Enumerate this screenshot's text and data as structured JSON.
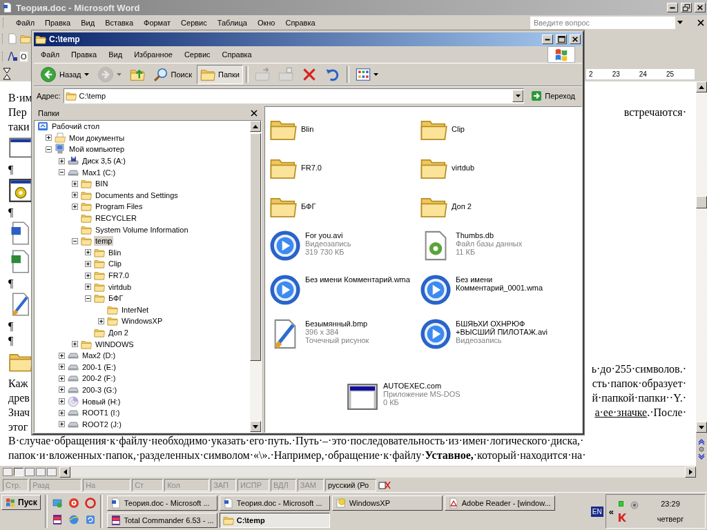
{
  "word": {
    "title": "Теория.doc - Microsoft Word",
    "menu": [
      "Файл",
      "Правка",
      "Вид",
      "Вставка",
      "Формат",
      "Сервис",
      "Таблица",
      "Окно",
      "Справка"
    ],
    "help": {
      "placeholder": "Введите вопрос"
    },
    "style_box": "О",
    "ruler": [
      "2",
      "23",
      "24",
      "25"
    ],
    "document": [
      {
        "kind": "text",
        "left": "В·им"
      },
      {
        "kind": "text",
        "left": "Пер",
        "right": "встречаются·"
      },
      {
        "kind": "text",
        "left": "таки"
      },
      {
        "kind": "window"
      },
      {
        "kind": "text",
        "left": "¶"
      },
      {
        "kind": "settings"
      },
      {
        "kind": "text",
        "left": "¶"
      },
      {
        "kind": "word"
      },
      {
        "kind": "excel"
      },
      {
        "kind": "text",
        "left": "¶"
      },
      {
        "kind": "paint"
      },
      {
        "kind": "text",
        "left": "¶"
      },
      {
        "kind": "text",
        "left": "¶"
      },
      {
        "kind": "folder",
        "right": "ь·до·255·символов.·"
      },
      {
        "kind": "text",
        "left": "Каж",
        "right": "сть·папок·образует·"
      },
      {
        "kind": "text",
        "left": "древ",
        "right": "й·папкой·папки··Y.·"
      },
      {
        "kind": "text",
        "left": "Знач",
        "right_underlined": "а·ее·значке",
        "right": ".·После·"
      },
      {
        "kind": "text",
        "left": "этог"
      },
      {
        "kind": "full",
        "text": "В·случае·обращения·к·файлу·необходимо·указать·его·путь.·Путь·–·это·последовательность·из·имен·логического·диска,·"
      },
      {
        "kind": "full",
        "text": "папок·и·вложенных·папок,·разделенных·символом·«\\».·Например,·обращение·к·файлу·**Уставное,**·который·находится·на·"
      }
    ],
    "status": [
      {
        "label": "Стр.",
        "disabled": true
      },
      {
        "label": "Разд",
        "disabled": true
      },
      {
        "label": "На",
        "disabled": true
      },
      {
        "label": "Ст",
        "disabled": true
      },
      {
        "label": "Кол",
        "disabled": true
      },
      {
        "label": "ЗАП",
        "disabled": true
      },
      {
        "label": "ИСПР",
        "disabled": true
      },
      {
        "label": "ВДЛ",
        "disabled": true
      },
      {
        "label": "ЗАМ",
        "disabled": true
      },
      {
        "label": "русский (Ро",
        "disabled": false
      }
    ]
  },
  "explorer": {
    "title": "C:\\temp",
    "menu": [
      "Файл",
      "Правка",
      "Вид",
      "Избранное",
      "Сервис",
      "Справка"
    ],
    "toolbar": [
      {
        "kind": "back",
        "label": "Назад",
        "disabled": false,
        "pressed": false
      },
      {
        "kind": "forward",
        "disabled": true,
        "pressed": false
      },
      {
        "kind": "up",
        "disabled": false,
        "pressed": false
      },
      {
        "kind": "search",
        "label": "Поиск",
        "disabled": false,
        "pressed": false
      },
      {
        "kind": "folders",
        "label": "Папки",
        "disabled": false,
        "pressed": true
      },
      {
        "kind": "move",
        "disabled": true,
        "pressed": false
      },
      {
        "kind": "copy",
        "disabled": true,
        "pressed": false
      },
      {
        "kind": "delete",
        "disabled": false,
        "pressed": false
      },
      {
        "kind": "undo",
        "disabled": false,
        "pressed": false
      },
      {
        "kind": "views",
        "disabled": false,
        "pressed": false
      }
    ],
    "address": {
      "label": "Адрес:",
      "value": "C:\\temp",
      "go": "Переход"
    },
    "folders_title": "Папки",
    "tree": [
      {
        "label": "Рабочий стол",
        "kind": "desktop",
        "selected": false,
        "children": [
          {
            "label": "Мои документы",
            "kind": "documents",
            "expandable": true,
            "expanded": false,
            "selected": false
          },
          {
            "label": "Мой компьютер",
            "kind": "computer",
            "expandable": true,
            "expanded": true,
            "selected": false,
            "children": [
              {
                "label": "Диск 3,5 (A:)",
                "kind": "floppy",
                "expandable": true,
                "expanded": false,
                "selected": false
              },
              {
                "label": "Max1 (C:)",
                "kind": "drive",
                "expandable": true,
                "expanded": true,
                "selected": false,
                "children": [
                  {
                    "label": "BIN",
                    "kind": "folder",
                    "expandable": true,
                    "expanded": false,
                    "selected": false
                  },
                  {
                    "label": "Documents and Settings",
                    "kind": "folder",
                    "expandable": true,
                    "expanded": false,
                    "selected": false
                  },
                  {
                    "label": "Program Files",
                    "kind": "folder",
                    "expandable": true,
                    "expanded": false,
                    "selected": false
                  },
                  {
                    "label": "RECYCLER",
                    "kind": "folder",
                    "expandable": false,
                    "selected": false
                  },
                  {
                    "label": "System Volume Information",
                    "kind": "folder",
                    "expandable": false,
                    "selected": false
                  },
                  {
                    "label": "temp",
                    "kind": "folder",
                    "expandable": true,
                    "expanded": true,
                    "selected": true,
                    "children": [
                      {
                        "label": "Blin",
                        "kind": "folder",
                        "expandable": true,
                        "expanded": false,
                        "selected": false
                      },
                      {
                        "label": "Clip",
                        "kind": "folder",
                        "expandable": true,
                        "expanded": false,
                        "selected": false
                      },
                      {
                        "label": "FR7.0",
                        "kind": "folder",
                        "expandable": true,
                        "expanded": false,
                        "selected": false
                      },
                      {
                        "label": "virtdub",
                        "kind": "folder",
                        "expandable": true,
                        "expanded": false,
                        "selected": false
                      },
                      {
                        "label": "БФГ",
                        "kind": "folder",
                        "expandable": true,
                        "expanded": true,
                        "selected": false,
                        "children": [
                          {
                            "label": "InterNet",
                            "kind": "folder",
                            "expandable": false,
                            "selected": false
                          },
                          {
                            "label": "WindowsXP",
                            "kind": "folder",
                            "expandable": true,
                            "expanded": false,
                            "selected": false
                          }
                        ]
                      },
                      {
                        "label": "Доп 2",
                        "kind": "folder",
                        "expandable": false,
                        "selected": false
                      }
                    ]
                  },
                  {
                    "label": "WINDOWS",
                    "kind": "folder",
                    "expandable": true,
                    "expanded": false,
                    "selected": false
                  }
                ]
              },
              {
                "label": "Max2 (D:)",
                "kind": "drive",
                "expandable": true,
                "expanded": false,
                "selected": false
              },
              {
                "label": "200-1 (E:)",
                "kind": "drive",
                "expandable": true,
                "expanded": false,
                "selected": false
              },
              {
                "label": "200-2 (F:)",
                "kind": "drive",
                "expandable": true,
                "expanded": false,
                "selected": false
              },
              {
                "label": "200-3 (G:)",
                "kind": "drive",
                "expandable": true,
                "expanded": false,
                "selected": false
              },
              {
                "label": "Новый (H:)",
                "kind": "cd",
                "expandable": true,
                "expanded": false,
                "selected": false
              },
              {
                "label": "ROOT1 (I:)",
                "kind": "drive",
                "expandable": true,
                "expanded": false,
                "selected": false
              },
              {
                "label": "ROOT2 (J:)",
                "kind": "drive",
                "expandable": true,
                "expanded": false,
                "selected": false
              }
            ]
          }
        ]
      }
    ],
    "files": [
      {
        "name": "Blin",
        "kind": "folder"
      },
      {
        "name": "Clip",
        "kind": "folder"
      },
      {
        "name": "FR7.0",
        "kind": "folder"
      },
      {
        "name": "virtdub",
        "kind": "folder"
      },
      {
        "name": "БФГ",
        "kind": "folder"
      },
      {
        "name": "Доп 2",
        "kind": "folder"
      },
      {
        "name": "For you.avi",
        "kind": "video",
        "details": [
          "Видеозапись",
          "319 730 КБ"
        ]
      },
      {
        "name": "Thumbs.db",
        "kind": "database",
        "details": [
          "Файл базы данных",
          "11 КБ"
        ]
      },
      {
        "name": "Без имени Комментарий.wma",
        "kind": "audio"
      },
      {
        "name": "Без имени Комментарий_0001.wma",
        "kind": "audio"
      },
      {
        "name": "Безымянный.bmp",
        "kind": "bitmap",
        "details": [
          "396 x 384",
          "Точечный рисунок"
        ]
      },
      {
        "name": "БШЯЬХИ ОХНРЮФ +ВЫСШИЙ ПИЛОТАЖ.avi",
        "kind": "video",
        "details": [
          "Видеозапись"
        ]
      },
      {
        "name": "AUTOEXEC.com",
        "kind": "app",
        "details": [
          "Приложение MS-DOS",
          "0 КБ"
        ]
      }
    ]
  },
  "taskbar": {
    "start": "Пуск",
    "tasks": [
      {
        "label": "Теория.doc - Microsoft ...",
        "kind": "word",
        "selected": false
      },
      {
        "label": "Теория.doc - Microsoft ...",
        "kind": "word",
        "selected": false
      },
      {
        "label": "WindowsXP",
        "kind": "help",
        "selected": false
      },
      {
        "label": "Adobe Reader - [window...",
        "kind": "pdf",
        "selected": false
      },
      {
        "label": "Total Commander 6.53 - ...",
        "kind": "winrar",
        "selected": false
      },
      {
        "label": "C:\\temp",
        "kind": "folder",
        "selected": true
      }
    ],
    "language": "EN",
    "expand": "«",
    "time": "23:29",
    "day": "четверг"
  }
}
